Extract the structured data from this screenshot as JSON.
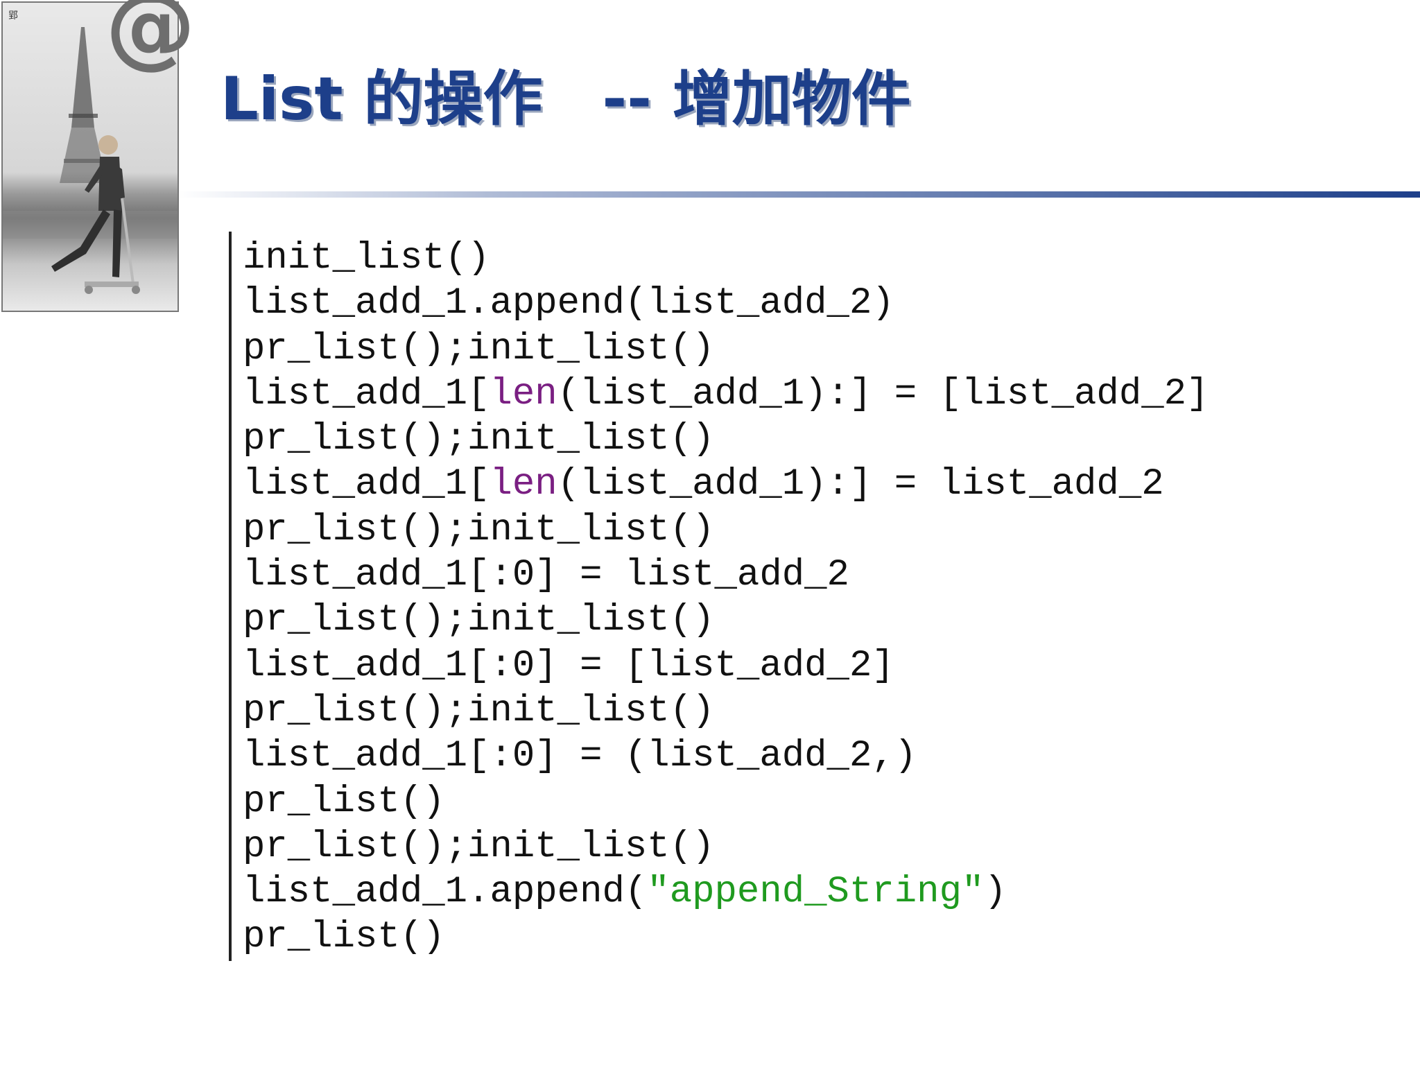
{
  "slide": {
    "title": "List 的操作　-- 增加物件",
    "corner_mark": "郢",
    "at_symbol": "@",
    "colors": {
      "title": "#1d3f8a",
      "rule": "#1d3f8a",
      "keyword": "#7a1f82",
      "string": "#1f9a1f"
    }
  },
  "code": {
    "lines": [
      {
        "parts": [
          {
            "text": "init_list()",
            "style": "plain"
          }
        ]
      },
      {
        "parts": [
          {
            "text": "list_add_1.append(list_add_2)",
            "style": "plain"
          }
        ]
      },
      {
        "parts": [
          {
            "text": "pr_list();init_list()",
            "style": "plain"
          }
        ]
      },
      {
        "parts": [
          {
            "text": "list_add_1[",
            "style": "plain"
          },
          {
            "text": "len",
            "style": "kw"
          },
          {
            "text": "(list_add_1):] = [list_add_2]",
            "style": "plain"
          }
        ]
      },
      {
        "parts": [
          {
            "text": "pr_list();init_list()",
            "style": "plain"
          }
        ]
      },
      {
        "parts": [
          {
            "text": "list_add_1[",
            "style": "plain"
          },
          {
            "text": "len",
            "style": "kw"
          },
          {
            "text": "(list_add_1):] = list_add_2",
            "style": "plain"
          }
        ]
      },
      {
        "parts": [
          {
            "text": "pr_list();init_list()",
            "style": "plain"
          }
        ]
      },
      {
        "parts": [
          {
            "text": "list_add_1[:0] = list_add_2",
            "style": "plain"
          }
        ]
      },
      {
        "parts": [
          {
            "text": "pr_list();init_list()",
            "style": "plain"
          }
        ]
      },
      {
        "parts": [
          {
            "text": "list_add_1[:0] = [list_add_2]",
            "style": "plain"
          }
        ]
      },
      {
        "parts": [
          {
            "text": "pr_list();init_list()",
            "style": "plain"
          }
        ]
      },
      {
        "parts": [
          {
            "text": "list_add_1[:0] = (list_add_2,)",
            "style": "plain"
          }
        ]
      },
      {
        "parts": [
          {
            "text": "pr_list()",
            "style": "plain"
          }
        ]
      },
      {
        "parts": [
          {
            "text": "pr_list();init_list()",
            "style": "plain"
          }
        ]
      },
      {
        "parts": [
          {
            "text": "list_add_1.append(",
            "style": "plain"
          },
          {
            "text": "\"append_String\"",
            "style": "str"
          },
          {
            "text": ")",
            "style": "plain"
          }
        ]
      },
      {
        "parts": [
          {
            "text": "pr_list()",
            "style": "plain"
          }
        ]
      }
    ]
  }
}
